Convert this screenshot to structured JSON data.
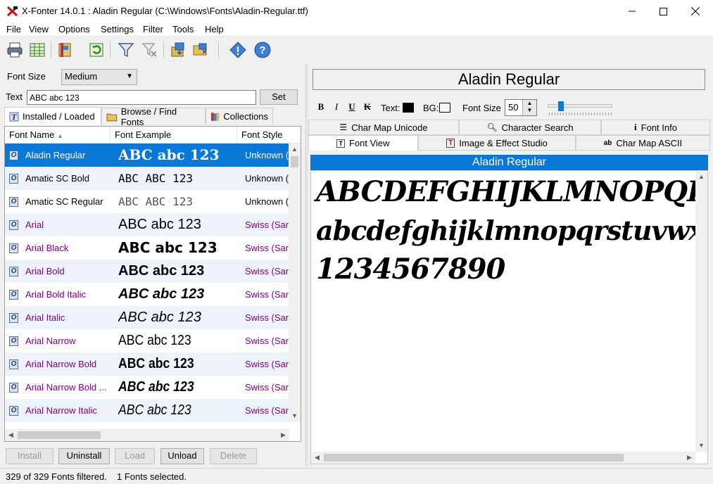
{
  "window": {
    "title": "X-Fonter 14.0.1  :  Aladin Regular (C:\\Windows\\Fonts\\Aladin-Regular.ttf)",
    "app_icon": "x-fonter-logo-icon",
    "controls": [
      "minimize-icon",
      "maximize-icon",
      "close-icon"
    ]
  },
  "menu": [
    "File",
    "View",
    "Options",
    "Settings",
    "Filter",
    "Tools",
    "Help"
  ],
  "toolbar": {
    "buttons": [
      "print-icon",
      "spreadsheet-icon",
      "book-icon",
      "refresh-icon",
      "filter-icon",
      "clear-filter-icon",
      "install-package-icon",
      "folder-open-icon",
      "diamond-info-icon",
      "help-icon"
    ]
  },
  "left": {
    "font_size_label": "Font Size",
    "font_size_value": "Medium",
    "text_label": "Text",
    "text_value": "ABC abc 123",
    "set_label": "Set",
    "tabs": [
      "Installed / Loaded",
      "Browse / Find Fonts",
      "Collections"
    ],
    "columns": [
      "Font Name",
      "Font Example",
      "Font Style"
    ],
    "rows": [
      {
        "name": "Aladin Regular",
        "example": "ABC abc 123",
        "style": "Unknown (",
        "selected": true
      },
      {
        "name": "Amatic SC Bold",
        "example": "ABC ABC 123",
        "style": "Unknown ("
      },
      {
        "name": "Amatic SC Regular",
        "example": "ABC ABC 123",
        "style": "Unknown ("
      },
      {
        "name": "Arial",
        "example": "ABC abc 123",
        "style": "Swiss (San"
      },
      {
        "name": "Arial Black",
        "example": "ABC abc 123",
        "style": "Swiss (San"
      },
      {
        "name": "Arial Bold",
        "example": "ABC abc 123",
        "style": "Swiss (San"
      },
      {
        "name": "Arial Bold Italic",
        "example": "ABC abc 123",
        "style": "Swiss (San"
      },
      {
        "name": "Arial Italic",
        "example": "ABC abc 123",
        "style": "Swiss (San"
      },
      {
        "name": "Arial Narrow",
        "example": "ABC abc 123",
        "style": "Swiss (San"
      },
      {
        "name": "Arial Narrow Bold",
        "example": "ABC abc 123",
        "style": "Swiss (San"
      },
      {
        "name": "Arial Narrow Bold ...",
        "example": "ABC abc 123",
        "style": "Swiss (San"
      },
      {
        "name": "Arial Narrow Italic",
        "example": "ABC abc 123",
        "style": "Swiss (San"
      }
    ],
    "buttons": [
      "Install",
      "Uninstall",
      "Load",
      "Unload",
      "Delete"
    ]
  },
  "right": {
    "font_title": "Aladin Regular",
    "format": {
      "bold": "B",
      "italic": "I",
      "underline": "U",
      "strike": "K",
      "text_label": "Text:",
      "text_color": "#000000",
      "bg_label": "BG:",
      "bg_color": "#ffffff",
      "size_label": "Font Size",
      "size_value": "50"
    },
    "tabs_row1": [
      "Char Map Unicode",
      "Character Search",
      "Font Info"
    ],
    "tabs_row2": [
      "Font View",
      "Image & Effect Studio",
      "Char Map ASCII"
    ],
    "preview_header": "Aladin Regular",
    "preview_lines": [
      "ABCDEFGHIJKLMNOPQRSTUVW",
      "abcdefghijklmnopqrstuvwxyz",
      "1234567890"
    ]
  },
  "status": {
    "filtered": "329 of 329 Fonts filtered.",
    "selected": "1 Fonts selected."
  },
  "colors": {
    "selection": "#0a78d7",
    "purple_text": "#800080"
  }
}
